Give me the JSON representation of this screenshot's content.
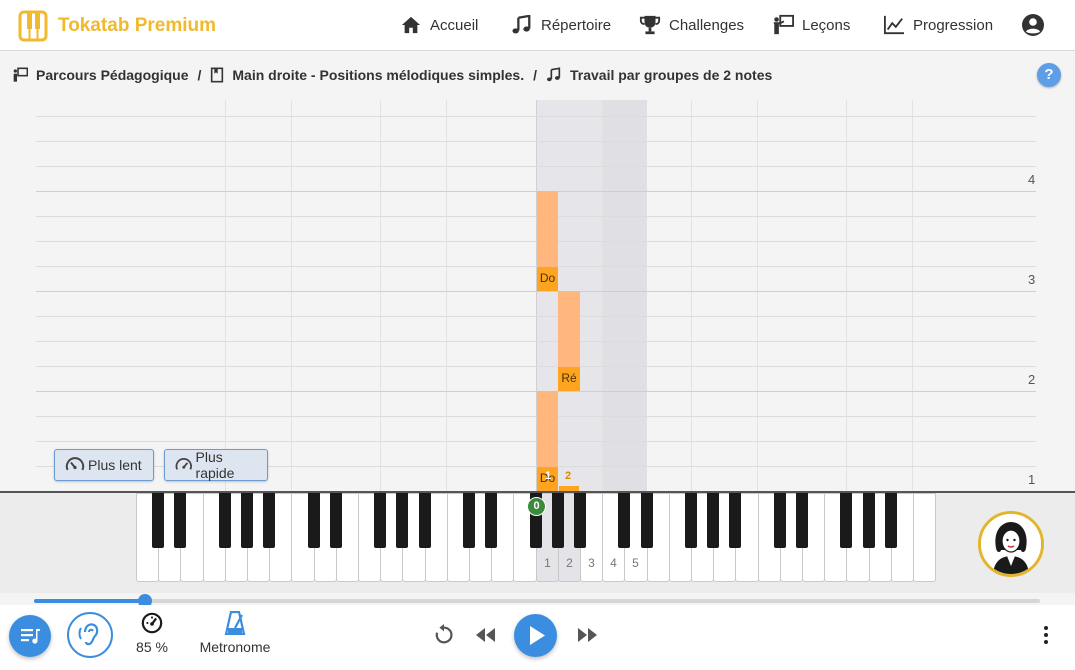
{
  "app": {
    "name": "Tokatab Premium"
  },
  "nav": [
    {
      "label": "Accueil",
      "icon": "home-icon"
    },
    {
      "label": "Répertoire",
      "icon": "music-note-icon"
    },
    {
      "label": "Challenges",
      "icon": "trophy-icon"
    },
    {
      "label": "Leçons",
      "icon": "teacher-icon"
    },
    {
      "label": "Progression",
      "icon": "chart-line-icon"
    }
  ],
  "breadcrumb": [
    {
      "label": "Parcours Pédagogique",
      "icon": "teacher-icon"
    },
    {
      "label": "Main droite - Positions mélodiques simples.",
      "icon": "book-icon"
    },
    {
      "label": "Travail par groupes de 2 notes",
      "icon": "music-note-icon"
    }
  ],
  "breadcrumb_separator": "/",
  "help_label": "?",
  "bar_numbers": [
    "4",
    "3",
    "2",
    "1"
  ],
  "notes": [
    {
      "name": "Do"
    },
    {
      "name": "Ré"
    },
    {
      "name": "Do",
      "finger": "1"
    },
    {
      "finger": "2"
    }
  ],
  "speed_buttons": {
    "slower": "Plus lent",
    "faster": "Plus rapide"
  },
  "keyboard": {
    "start_badge": "0",
    "fingerings": [
      "1",
      "2",
      "3",
      "4",
      "5"
    ]
  },
  "playback": {
    "progress": 0.11,
    "speed_value": "85 %",
    "metronome_label": "Metronome"
  },
  "colors": {
    "accent": "#3b8de0",
    "brand": "#f0b92e",
    "note_head": "#ffa421",
    "note_tail": "#ffb77d"
  }
}
